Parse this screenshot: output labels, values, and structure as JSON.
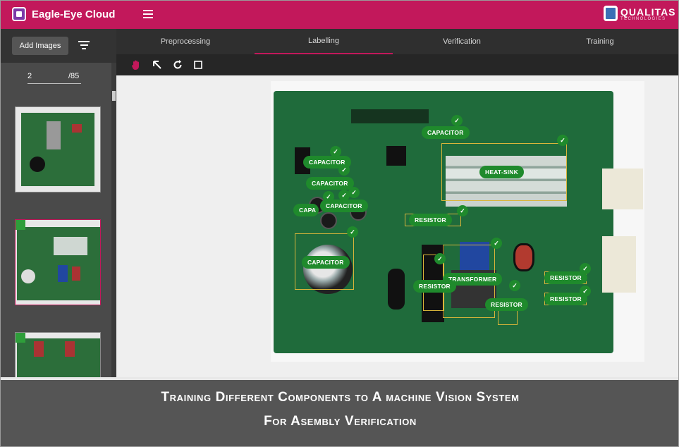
{
  "header": {
    "app_title": "Eagle-Eye Cloud",
    "brand_name": "QUALITAS",
    "brand_sub": "TECHNOLOGIES",
    "accent_color": "#c2185b"
  },
  "sidebar": {
    "add_images_label": "Add Images",
    "filter_icon": "filter-icon",
    "pager": {
      "current": "2",
      "total": "/85"
    }
  },
  "tabs": [
    {
      "label": "Preprocessing",
      "active": false
    },
    {
      "label": "Labelling",
      "active": true
    },
    {
      "label": "Verification",
      "active": false
    },
    {
      "label": "Training",
      "active": false
    }
  ],
  "toolbar": {
    "tools": [
      "hand-icon",
      "arrow-icon",
      "rotate-icon",
      "square-icon"
    ]
  },
  "annotations": {
    "labels": [
      "CAPACITOR",
      "HEAT-SINK",
      "CAPACITOR",
      "CAPACITOR",
      "CAPACITOR",
      "CAPA",
      "RESISTOR",
      "CAPACITOR",
      "TRANSFORMER",
      "RESISTOR",
      "RESISTOR",
      "RESISTOR",
      "RESISTOR"
    ],
    "check": "✓"
  },
  "caption": {
    "line1": "Training Different Components to A machine Vision System",
    "line2": "For Asembly Verification"
  }
}
